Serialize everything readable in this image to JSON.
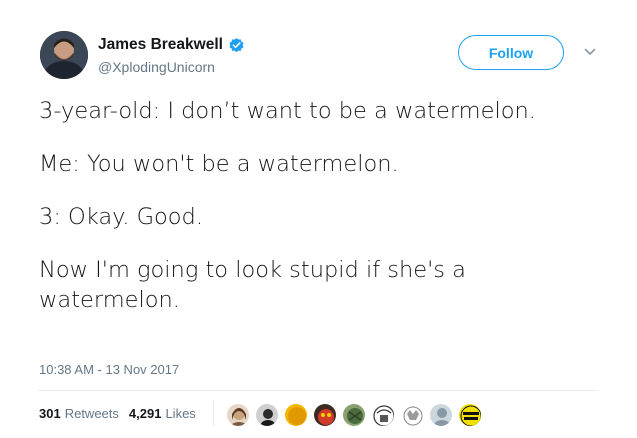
{
  "author": {
    "name": "James Breakwell",
    "handle": "@XplodingUnicorn",
    "verified": true,
    "avatar_icon": "profile-photo"
  },
  "follow_button": {
    "label": "Follow"
  },
  "menu": {
    "icon": "chevron-down-icon"
  },
  "tweet": {
    "lines": [
      "3-year-old: I don’t want to be a watermelon.",
      "Me: You won't be a watermelon.",
      "3: Okay. Good.",
      "Now I'm going to look stupid if she's a watermelon."
    ],
    "timestamp": "10:38 AM - 13 Nov 2017"
  },
  "stats": {
    "retweets_count": "301",
    "retweets_label": "Retweets",
    "likes_count": "4,291",
    "likes_label": "Likes"
  },
  "likers": [
    {
      "icon": "liker-avatar-1",
      "color": "#c9a27e"
    },
    {
      "icon": "liker-avatar-2",
      "color": "#3a3a3a"
    },
    {
      "icon": "liker-avatar-3",
      "color": "#e8a800"
    },
    {
      "icon": "liker-avatar-4",
      "color": "#d23a2a"
    },
    {
      "icon": "liker-avatar-5",
      "color": "#4a6b3c"
    },
    {
      "icon": "liker-avatar-6",
      "color": "#777777"
    },
    {
      "icon": "liker-avatar-7",
      "color": "#9a9a9a"
    },
    {
      "icon": "liker-avatar-8",
      "color": "#b8c2cc"
    },
    {
      "icon": "liker-avatar-9",
      "color": "#f0e000"
    }
  ],
  "colors": {
    "accent": "#1da1f2",
    "text": "#14171a",
    "muted": "#657786",
    "divider": "#e6ecf0"
  }
}
